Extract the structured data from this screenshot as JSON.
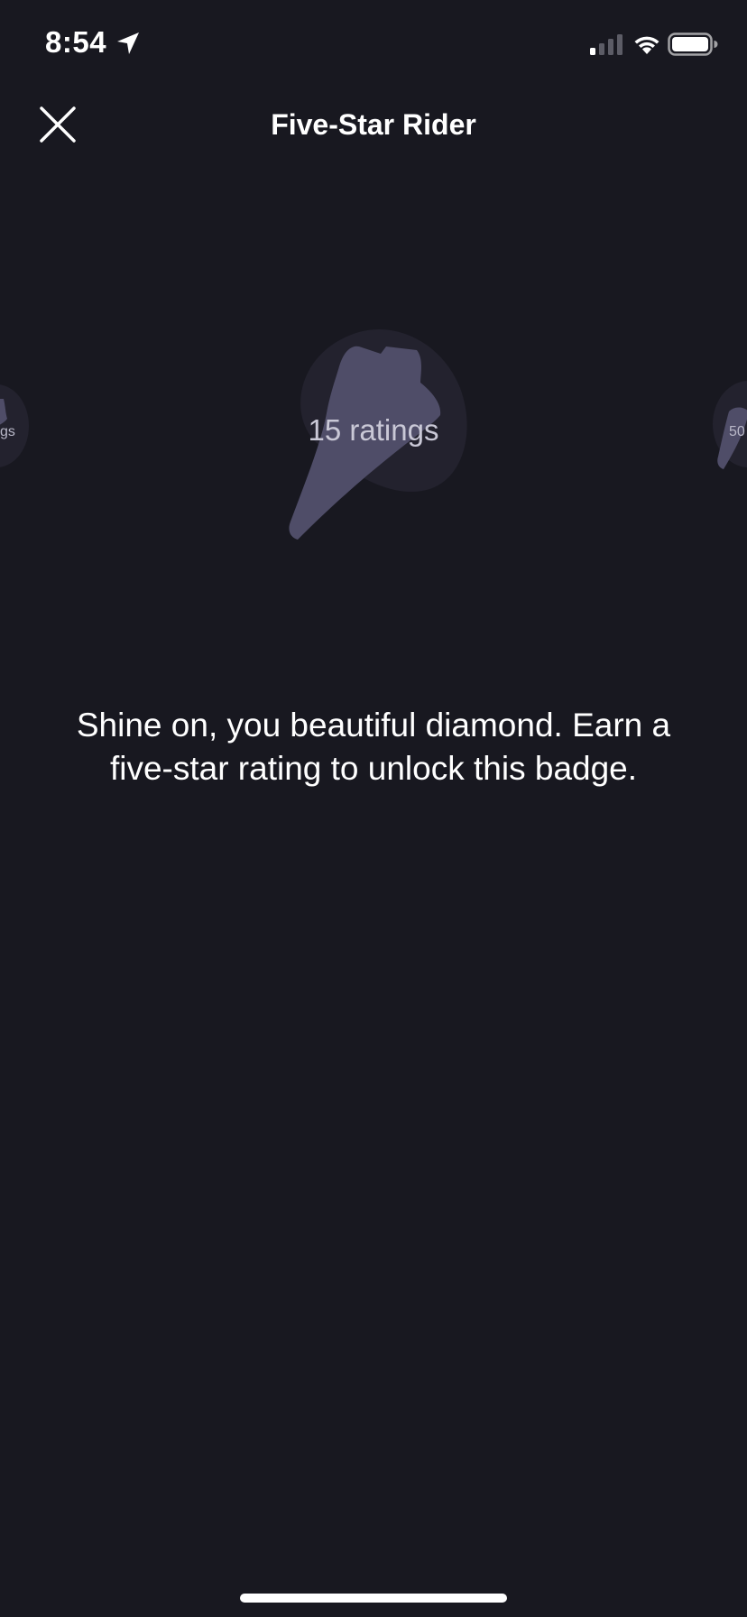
{
  "status_bar": {
    "time": "8:54",
    "icons": [
      "location-arrow-icon",
      "cellular-signal-icon",
      "wifi-icon",
      "battery-icon"
    ]
  },
  "header": {
    "title": "Five-Star Rider",
    "close_icon": "close-icon"
  },
  "carousel": {
    "current_badge": {
      "label": "15 ratings"
    },
    "left_badge": {
      "label": "gs"
    },
    "right_badge": {
      "label": "50"
    }
  },
  "description": {
    "text": "Shine on, you beautiful diamond. Earn a five-star rating to unlock this badge."
  },
  "colors": {
    "background": "#181820",
    "badge_outer": "#23222e",
    "badge_inner": "#4f4d68",
    "text_primary": "#ffffff",
    "text_muted": "#c9c8d6"
  }
}
